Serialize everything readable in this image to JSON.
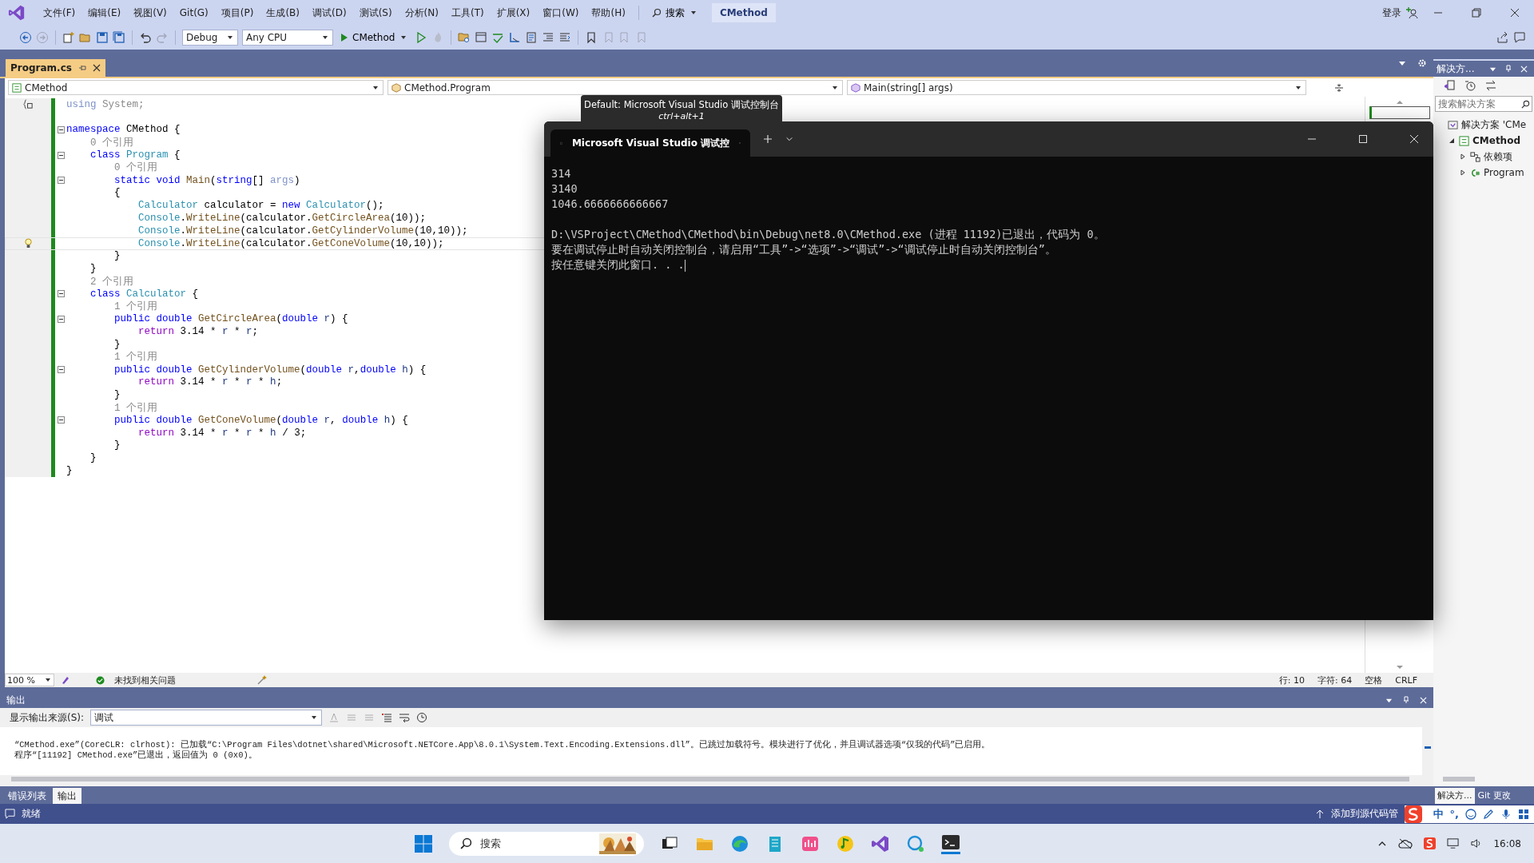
{
  "menu_bar": {
    "items": [
      "文件(F)",
      "编辑(E)",
      "视图(V)",
      "Git(G)",
      "项目(P)",
      "生成(B)",
      "调试(D)",
      "测试(S)",
      "分析(N)",
      "工具(T)",
      "扩展(X)",
      "窗口(W)",
      "帮助(H)"
    ],
    "search": "搜索",
    "solution_name": "CMethod",
    "sign_in": "登录"
  },
  "toolbar": {
    "configuration": "Debug",
    "platform": "Any CPU",
    "start": "CMethod"
  },
  "document_tabs": [
    {
      "label": "Program.cs",
      "selected": true
    }
  ],
  "nav_bar": {
    "project": "CMethod",
    "class": "CMethod.Program",
    "member": "Main(string[] args)"
  },
  "code_lines": [
    {
      "fold": false,
      "tokens": [
        {
          "t": "using",
          "kind": "faded"
        },
        {
          "t": " System;",
          "kind": "dim"
        }
      ]
    },
    {
      "fold": false
    },
    {
      "fold": true,
      "tokens": [
        {
          "t": "namespace",
          "kind": "kw"
        },
        {
          "t": " CMethod {",
          "kind": "plain"
        }
      ]
    },
    {
      "fold": false,
      "tokens": [
        {
          "t": "    0 个引用",
          "kind": "lens"
        }
      ]
    },
    {
      "fold": true,
      "tokens": [
        {
          "t": "    class",
          "kind": "kw"
        },
        {
          "t": " Program",
          "kind": "type"
        },
        {
          "t": " {",
          "kind": "plain"
        }
      ]
    },
    {
      "fold": false,
      "tokens": [
        {
          "t": "        0 个引用",
          "kind": "lens"
        }
      ]
    },
    {
      "fold": true,
      "tokens": [
        {
          "t": "        static void",
          "kind": "kw"
        },
        {
          "t": " Main",
          "kind": "method"
        },
        {
          "t": "(",
          "kind": "plain"
        },
        {
          "t": "string",
          "kind": "kw"
        },
        {
          "t": "[] ",
          "kind": "plain"
        },
        {
          "t": "args",
          "kind": "faded"
        },
        {
          "t": ")",
          "kind": "plain"
        }
      ]
    },
    {
      "fold": false,
      "tokens": [
        {
          "t": "        {",
          "kind": "plain"
        }
      ]
    },
    {
      "fold": false,
      "tokens": [
        {
          "t": "            Calculator",
          "kind": "type"
        },
        {
          "t": " calculator = ",
          "kind": "plain"
        },
        {
          "t": "new",
          "kind": "kw"
        },
        {
          "t": " Calculator",
          "kind": "type"
        },
        {
          "t": "();",
          "kind": "plain"
        }
      ]
    },
    {
      "fold": false,
      "tokens": [
        {
          "t": "            Console",
          "kind": "type"
        },
        {
          "t": ".",
          "kind": "plain"
        },
        {
          "t": "WriteLine",
          "kind": "method"
        },
        {
          "t": "(calculator.",
          "kind": "plain"
        },
        {
          "t": "GetCircleArea",
          "kind": "method"
        },
        {
          "t": "(10));",
          "kind": "plain"
        }
      ]
    },
    {
      "fold": false,
      "tokens": [
        {
          "t": "            Console",
          "kind": "type"
        },
        {
          "t": ".",
          "kind": "plain"
        },
        {
          "t": "WriteLine",
          "kind": "method"
        },
        {
          "t": "(calculator.",
          "kind": "plain"
        },
        {
          "t": "GetCylinderVolume",
          "kind": "method"
        },
        {
          "t": "(10,10));",
          "kind": "plain"
        }
      ]
    },
    {
      "fold": false,
      "current": true,
      "lightbulb": true,
      "tokens": [
        {
          "t": "            Console",
          "kind": "type"
        },
        {
          "t": ".",
          "kind": "plain"
        },
        {
          "t": "WriteLine",
          "kind": "method"
        },
        {
          "t": "(calculator.",
          "kind": "plain"
        },
        {
          "t": "GetConeVolume",
          "kind": "method"
        },
        {
          "t": "(10,10));",
          "kind": "plain"
        }
      ]
    },
    {
      "fold": false,
      "tokens": [
        {
          "t": "        }",
          "kind": "plain"
        }
      ]
    },
    {
      "fold": false,
      "tokens": [
        {
          "t": "    }",
          "kind": "plain"
        }
      ]
    },
    {
      "fold": false,
      "tokens": [
        {
          "t": "    2 个引用",
          "kind": "lens"
        }
      ]
    },
    {
      "fold": true,
      "tokens": [
        {
          "t": "    class",
          "kind": "kw"
        },
        {
          "t": " Calculator",
          "kind": "type"
        },
        {
          "t": " {",
          "kind": "plain"
        }
      ]
    },
    {
      "fold": false,
      "tokens": [
        {
          "t": "        1 个引用",
          "kind": "lens"
        }
      ]
    },
    {
      "fold": true,
      "tokens": [
        {
          "t": "        public double",
          "kind": "kw"
        },
        {
          "t": " GetCircleArea",
          "kind": "method"
        },
        {
          "t": "(",
          "kind": "plain"
        },
        {
          "t": "double",
          "kind": "kw"
        },
        {
          "t": " r",
          "kind": "param"
        },
        {
          "t": ") {",
          "kind": "plain"
        }
      ]
    },
    {
      "fold": false,
      "tokens": [
        {
          "t": "            return",
          "kind": "ctrl"
        },
        {
          "t": " 3.14 * ",
          "kind": "plain"
        },
        {
          "t": "r",
          "kind": "param"
        },
        {
          "t": " * ",
          "kind": "plain"
        },
        {
          "t": "r",
          "kind": "param"
        },
        {
          "t": ";",
          "kind": "plain"
        }
      ]
    },
    {
      "fold": false,
      "tokens": [
        {
          "t": "        }",
          "kind": "plain"
        }
      ]
    },
    {
      "fold": false,
      "tokens": [
        {
          "t": "        1 个引用",
          "kind": "lens"
        }
      ]
    },
    {
      "fold": true,
      "tokens": [
        {
          "t": "        public double",
          "kind": "kw"
        },
        {
          "t": " GetCylinderVolume",
          "kind": "method"
        },
        {
          "t": "(",
          "kind": "plain"
        },
        {
          "t": "double",
          "kind": "kw"
        },
        {
          "t": " r",
          "kind": "param"
        },
        {
          "t": ",",
          "kind": "plain"
        },
        {
          "t": "double",
          "kind": "kw"
        },
        {
          "t": " h",
          "kind": "param"
        },
        {
          "t": ") {",
          "kind": "plain"
        }
      ]
    },
    {
      "fold": false,
      "tokens": [
        {
          "t": "            return",
          "kind": "ctrl"
        },
        {
          "t": " 3.14 * ",
          "kind": "plain"
        },
        {
          "t": "r",
          "kind": "param"
        },
        {
          "t": " * ",
          "kind": "plain"
        },
        {
          "t": "r",
          "kind": "param"
        },
        {
          "t": " * ",
          "kind": "plain"
        },
        {
          "t": "h",
          "kind": "param"
        },
        {
          "t": ";",
          "kind": "plain"
        }
      ]
    },
    {
      "fold": false,
      "tokens": [
        {
          "t": "        }",
          "kind": "plain"
        }
      ]
    },
    {
      "fold": false,
      "tokens": [
        {
          "t": "        1 个引用",
          "kind": "lens"
        }
      ]
    },
    {
      "fold": true,
      "tokens": [
        {
          "t": "        public double",
          "kind": "kw"
        },
        {
          "t": " GetConeVolume",
          "kind": "method"
        },
        {
          "t": "(",
          "kind": "plain"
        },
        {
          "t": "double",
          "kind": "kw"
        },
        {
          "t": " r",
          "kind": "param"
        },
        {
          "t": ", ",
          "kind": "plain"
        },
        {
          "t": "double",
          "kind": "kw"
        },
        {
          "t": " h",
          "kind": "param"
        },
        {
          "t": ") {",
          "kind": "plain"
        }
      ]
    },
    {
      "fold": false,
      "tokens": [
        {
          "t": "            return",
          "kind": "ctrl"
        },
        {
          "t": " 3.14 * ",
          "kind": "plain"
        },
        {
          "t": "r",
          "kind": "param"
        },
        {
          "t": " * ",
          "kind": "plain"
        },
        {
          "t": "r",
          "kind": "param"
        },
        {
          "t": " * ",
          "kind": "plain"
        },
        {
          "t": "h",
          "kind": "param"
        },
        {
          "t": " / 3;",
          "kind": "plain"
        }
      ]
    },
    {
      "fold": false,
      "tokens": [
        {
          "t": "        }",
          "kind": "plain"
        }
      ]
    },
    {
      "fold": false,
      "tokens": [
        {
          "t": "    }",
          "kind": "plain"
        }
      ]
    },
    {
      "fold": false,
      "tokens": [
        {
          "t": "}",
          "kind": "plain"
        }
      ]
    }
  ],
  "editor_status": {
    "zoom": "100 %",
    "issues": "未找到相关问题",
    "line": "行: 10",
    "char": "字符: 64",
    "whitespace": "空格",
    "line_ending": "CRLF"
  },
  "output_panel": {
    "title": "输出",
    "source_label": "显示输出来源(S):",
    "source": "调试",
    "lines": [
      "“CMethod.exe”(CoreCLR: clrhost): 已加载“C:\\Program Files\\dotnet\\shared\\Microsoft.NETCore.App\\8.0.1\\System.Text.Encoding.Extensions.dll”。已跳过加载符号。模块进行了优化，并且调试器选项“仅我的代码”已启用。",
      "程序“[11192] CMethod.exe”已退出，返回值为 0 (0x0)。"
    ]
  },
  "bottom_tabs": [
    {
      "label": "错误列表",
      "selected": false
    },
    {
      "label": "输出",
      "selected": true
    }
  ],
  "solution_explorer": {
    "title": "解决方...",
    "search_placeholder": "搜索解决方案",
    "tree": [
      {
        "label": "解决方案 'CMe",
        "kind": "solution",
        "children": [
          {
            "label": "CMethod",
            "kind": "project",
            "expanded": true,
            "children": [
              {
                "label": "依赖项",
                "kind": "deps",
                "expanded": false
              },
              {
                "label": "Program",
                "kind": "file",
                "expanded": false
              }
            ]
          }
        ]
      }
    ],
    "tabs": [
      {
        "label": "解决方...",
        "selected": true
      },
      {
        "label": "Git 更改",
        "selected": false
      }
    ]
  },
  "status_bar": {
    "text": "就绪",
    "source_control": "添加到源代码管"
  },
  "ime": {
    "items": [
      "中",
      "°,"
    ]
  },
  "tooltip": {
    "title": "Default: Microsoft Visual Studio 调试控制台",
    "shortcut": "ctrl+alt+1"
  },
  "console": {
    "tab_title": "Microsoft Visual Studio 调试控",
    "results": [
      "314",
      "3140",
      "1046.6666666666667"
    ],
    "messages": [
      "D:\\VSProject\\CMethod\\CMethod\\bin\\Debug\\net8.0\\CMethod.exe (进程 11192)已退出，代码为 0。",
      "要在调试停止时自动关闭控制台，请启用“工具”->“选项”->“调试”->“调试停止时自动关闭控制台”。",
      "按任意键关闭此窗口. . ."
    ]
  },
  "taskbar": {
    "search": "搜索",
    "time": "16:08"
  }
}
